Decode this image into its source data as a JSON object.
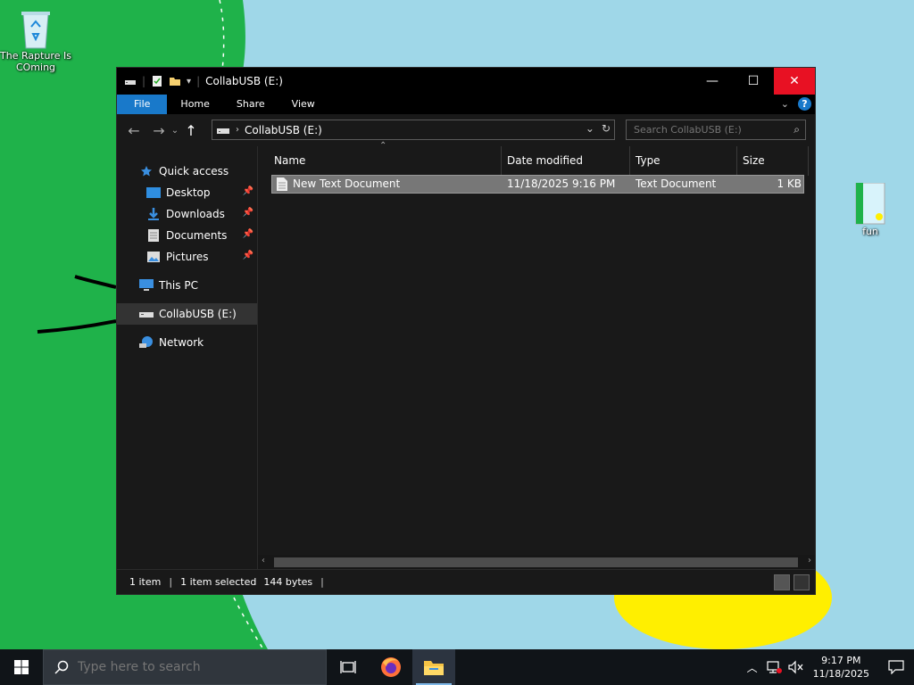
{
  "desktop": {
    "icons": [
      {
        "label": "The Rapture Is COming"
      },
      {
        "label": "fun"
      }
    ],
    "colors": {
      "green": "#1fb24a",
      "sky": "#9fd7e8",
      "yellow": "#ffef00"
    }
  },
  "window": {
    "title": "CollabUSB (E:)",
    "ribbon_tabs": [
      "File",
      "Home",
      "Share",
      "View"
    ],
    "address": "CollabUSB (E:)",
    "search_placeholder": "Search CollabUSB (E:)",
    "nav": [
      {
        "label": "Quick access",
        "icon": "star-icon",
        "pinned": false
      },
      {
        "label": "Desktop",
        "icon": "desktop-icon",
        "pinned": true
      },
      {
        "label": "Downloads",
        "icon": "download-icon",
        "pinned": true
      },
      {
        "label": "Documents",
        "icon": "document-icon",
        "pinned": true
      },
      {
        "label": "Pictures",
        "icon": "pictures-icon",
        "pinned": true
      },
      {
        "label": "This PC",
        "icon": "computer-icon",
        "pinned": false
      },
      {
        "label": "CollabUSB (E:)",
        "icon": "drive-icon",
        "pinned": false,
        "selected": true
      },
      {
        "label": "Network",
        "icon": "network-icon",
        "pinned": false
      }
    ],
    "columns": {
      "name": "Name",
      "date": "Date modified",
      "type": "Type",
      "size": "Size"
    },
    "files": [
      {
        "name": "New Text Document",
        "date": "11/18/2025 9:16 PM",
        "type": "Text Document",
        "size": "1 KB"
      }
    ],
    "status": {
      "count": "1 item",
      "selected": "1 item selected",
      "bytes": "144 bytes"
    }
  },
  "taskbar": {
    "search_placeholder": "Type here to search",
    "time": "9:17 PM",
    "date": "11/18/2025"
  }
}
